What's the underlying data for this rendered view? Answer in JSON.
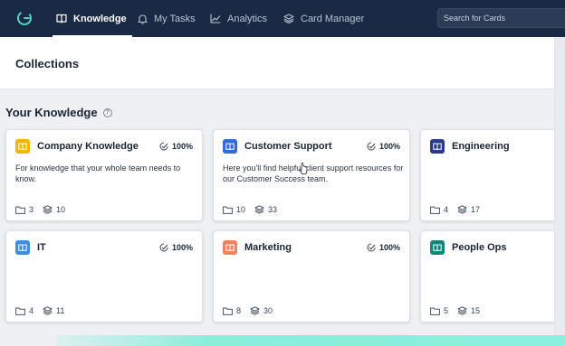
{
  "nav": {
    "items": [
      {
        "label": "Knowledge",
        "icon": "book-icon",
        "active": true
      },
      {
        "label": "My Tasks",
        "icon": "bell-icon",
        "active": false
      },
      {
        "label": "Analytics",
        "icon": "line-chart-icon",
        "active": false
      },
      {
        "label": "Card Manager",
        "icon": "card-stack-icon",
        "active": false
      }
    ],
    "search_placeholder": "Search for Cards"
  },
  "page": {
    "title": "Collections",
    "section_title": "Your Knowledge",
    "help_glyph": "?"
  },
  "cards": [
    {
      "name": "Company Knowledge",
      "color": "#f4b400",
      "percent": "100%",
      "description": "For knowledge that your whole team needs to know.",
      "folders": "3",
      "cards": "10"
    },
    {
      "name": "Customer Support",
      "color": "#2f6bd9",
      "percent": "100%",
      "description": "Here you'll find helpful client support resources for our Customer Success team.",
      "folders": "10",
      "cards": "33"
    },
    {
      "name": "Engineering",
      "color": "#2b3a8c",
      "percent": "",
      "description": "",
      "folders": "4",
      "cards": "17"
    },
    {
      "name": "IT",
      "color": "#3b8fe0",
      "percent": "100%",
      "description": "",
      "folders": "4",
      "cards": "11"
    },
    {
      "name": "Marketing",
      "color": "#f0835a",
      "percent": "100%",
      "description": "",
      "folders": "8",
      "cards": "30"
    },
    {
      "name": "People Ops",
      "color": "#13867a",
      "percent": "",
      "description": "",
      "folders": "5",
      "cards": "15"
    }
  ],
  "colors": {
    "nav_bg": "#1b2a44",
    "accent_glow": "#78eed7"
  }
}
